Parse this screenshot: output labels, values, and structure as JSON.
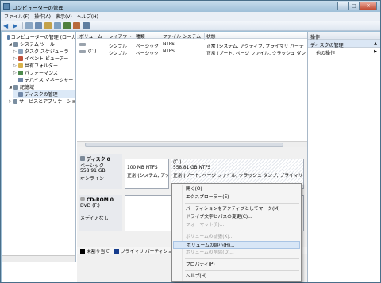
{
  "window": {
    "title": "コンピューターの管理"
  },
  "menubar": [
    "ファイル(F)",
    "操作(A)",
    "表示(V)",
    "ヘルプ(H)"
  ],
  "tree": [
    {
      "label": "コンピューターの管理 (ローカ",
      "indent": 0,
      "icon_color": "#5a7ea8",
      "expander": ""
    },
    {
      "label": "システム ツール",
      "indent": 1,
      "icon_color": "#7a8ea0",
      "expander": "◢"
    },
    {
      "label": "タスク スケジューラ",
      "indent": 2,
      "icon_color": "#8aa2bc",
      "expander": "▷"
    },
    {
      "label": "イベント ビューアー",
      "indent": 2,
      "icon_color": "#c0503a",
      "expander": "▷"
    },
    {
      "label": "共有フォルダー",
      "indent": 2,
      "icon_color": "#d8b24a",
      "expander": "▷"
    },
    {
      "label": "パフォーマンス",
      "indent": 2,
      "icon_color": "#4c8a4c",
      "expander": "▷"
    },
    {
      "label": "デバイス マネージャー",
      "indent": 2,
      "icon_color": "#6f86a6",
      "expander": ""
    },
    {
      "label": "記憶域",
      "indent": 1,
      "icon_color": "#7a8ea0",
      "expander": "◢"
    },
    {
      "label": "ディスクの管理",
      "indent": 2,
      "icon_color": "#7088a8",
      "expander": "",
      "selected": true
    },
    {
      "label": "サービスとアプリケーショ",
      "indent": 1,
      "icon_color": "#7a8ea0",
      "expander": "▷"
    }
  ],
  "volume_columns": [
    "ボリューム",
    "レイアウト",
    "種類",
    "ファイル システム",
    "状態"
  ],
  "volumes": [
    {
      "name": "",
      "layout": "シンプル",
      "type": "ベーシック",
      "fs": "NTFS",
      "status": "正常 (システム, アクティブ, プライマリ パーテ"
    },
    {
      "name": "(C:)",
      "layout": "シンプル",
      "type": "ベーシック",
      "fs": "NTFS",
      "status": "正常 (ブート, ページ ファイル, クラッシュ ダン"
    }
  ],
  "disk0": {
    "name": "ディスク 0",
    "type": "ベーシック",
    "size": "558.91 GB",
    "state": "オンライン",
    "partitions": [
      {
        "line1": "",
        "line2": "100 MB NTFS",
        "line3": "正常 (システム, アク"
      },
      {
        "line1": "(C:)",
        "line2": "558.81 GB NTFS",
        "line3": "正常 (ブート, ページ ファイル, クラッシュ ダンプ, プライマリ"
      }
    ]
  },
  "cdrom0": {
    "name": "CD-ROM 0",
    "drive": "DVD (F:)",
    "media": "メディアなし"
  },
  "legend": [
    {
      "label": "未割り当て",
      "color": "#000000"
    },
    {
      "label": "プライマリ パーティショ",
      "color": "#163c8c"
    }
  ],
  "actions": {
    "header": "操作",
    "section": "ディスクの管理",
    "item": "他の操作"
  },
  "context_menu": [
    {
      "label": "開く(O)",
      "disabled": false
    },
    {
      "label": "エクスプローラー(E)",
      "disabled": false
    },
    {
      "sep": true
    },
    {
      "label": "パーティションをアクティブとしてマーク(M)",
      "disabled": false
    },
    {
      "label": "ドライブ文字とパスの変更(C)...",
      "disabled": false
    },
    {
      "label": "フォーマット(F)...",
      "disabled": true
    },
    {
      "sep": true
    },
    {
      "label": "ボリュームの拡張(X)...",
      "disabled": true
    },
    {
      "label": "ボリュームの縮小(H)...",
      "disabled": false,
      "highlight": true
    },
    {
      "label": "ボリュームの削除(D)...",
      "disabled": true
    },
    {
      "sep": true
    },
    {
      "label": "プロパティ(P)",
      "disabled": false
    },
    {
      "sep": true
    },
    {
      "label": "ヘルプ(H)",
      "disabled": false
    }
  ]
}
